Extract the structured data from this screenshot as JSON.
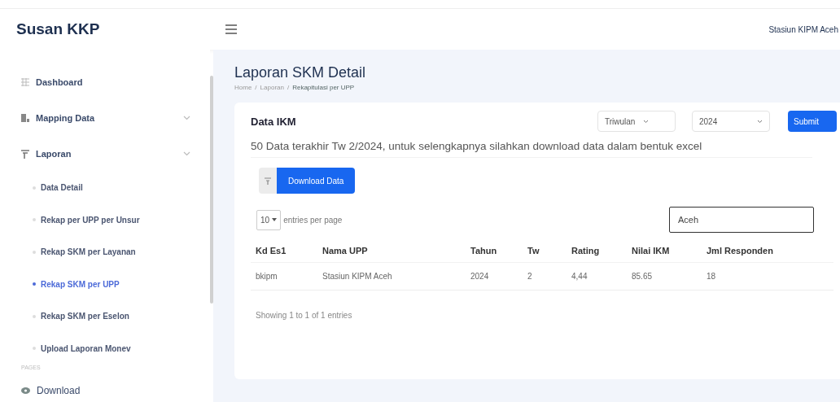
{
  "brand": "Susan KKP",
  "header": {
    "user": "Stasiun KIPM Aceh"
  },
  "sidebar": {
    "items": [
      {
        "label": "Dashboard",
        "kind": "link"
      },
      {
        "label": "Mapping Data",
        "kind": "group"
      },
      {
        "label": "Laporan",
        "kind": "group",
        "expanded": true,
        "children": [
          {
            "label": "Data Detail",
            "selected": false
          },
          {
            "label": "Rekap per UPP per Unsur",
            "selected": false
          },
          {
            "label": "Rekap SKM per Layanan",
            "selected": false
          },
          {
            "label": "Rekap SKM per UPP",
            "selected": true
          },
          {
            "label": "Rekap SKM per Eselon",
            "selected": false
          },
          {
            "label": "Upload Laporan Monev",
            "selected": false
          }
        ]
      }
    ],
    "section": "PAGES",
    "bottom_item": {
      "label": "Download"
    }
  },
  "page": {
    "title": "Laporan SKM Detail",
    "breadcrumb": [
      "Home",
      "/",
      "Laporan",
      "/",
      "Rekapitulasi per UPP"
    ]
  },
  "card": {
    "title": "Data IKM",
    "period_select": "Triwulan",
    "year_select": "2024",
    "submit": "Submit",
    "note": "50 Data terakhir Tw 2/2024, untuk selengkapnya silahkan download data dalam bentuk excel",
    "download": "Download Data",
    "per_page": "10",
    "per_page_label": "entries per page",
    "search": "Aceh",
    "table": {
      "columns": [
        "Kd Es1",
        "Nama UPP",
        "Tahun",
        "Tw",
        "Rating",
        "Nilai IKM",
        "Jml Responden"
      ],
      "rows": [
        [
          "bkipm",
          "Stasiun KIPM Aceh",
          "2024",
          "2",
          "4,44",
          "85.65",
          "18"
        ]
      ]
    },
    "footer": "Showing 1 to 1 of 1 entries"
  }
}
